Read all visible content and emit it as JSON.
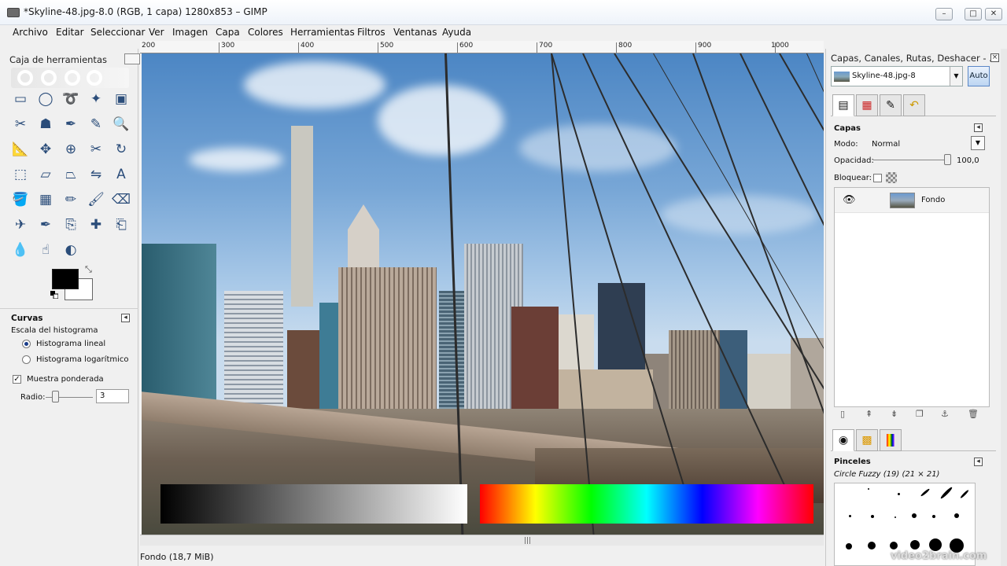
{
  "window": {
    "title": "*Skyline-48.jpg-8.0 (RGB, 1 capa) 1280x853 – GIMP",
    "controls": [
      "–",
      "□",
      "✕"
    ]
  },
  "menu": [
    "Archivo",
    "Editar",
    "Seleccionar",
    "Ver",
    "Imagen",
    "Capa",
    "Colores",
    "Herramientas",
    "Filtros",
    "Ventanas",
    "Ayuda"
  ],
  "toolbox": {
    "title": "Caja de herramientas",
    "tools": [
      "rect-select",
      "ellipse-select",
      "free-select",
      "fuzzy-select",
      "color-select",
      "scissors-select",
      "foreground-select",
      "paths",
      "color-picker",
      "zoom",
      "measure",
      "move",
      "align",
      "crop",
      "rotate",
      "scale",
      "shear",
      "perspective",
      "flip",
      "text",
      "bucket-fill",
      "blend",
      "pencil",
      "paintbrush",
      "eraser",
      "airbrush",
      "ink",
      "clone",
      "heal",
      "perspective-clone",
      "blur",
      "smudge",
      "dodge-burn"
    ],
    "fg_color": "#000000",
    "bg_color": "#ffffff"
  },
  "tool_options": {
    "title": "Curvas",
    "histogram_label": "Escala del histograma",
    "option_linear": "Histograma lineal",
    "option_log": "Histograma logarítmico",
    "weighted_label": "Muestra ponderada",
    "radius_label": "Radio:",
    "radius_value": "3"
  },
  "ruler": {
    "corner": "200",
    "labels": [
      "200",
      "300",
      "400",
      "500",
      "600",
      "700",
      "800",
      "900",
      "1000"
    ]
  },
  "status": {
    "text": "Fondo (18,7 MiB)"
  },
  "right_dock": {
    "title": "Capas, Canales, Rutas, Deshacer - ...",
    "image_name": "Skyline-48.jpg-8",
    "auto_label": "Auto",
    "layers_title": "Capas",
    "mode_label": "Modo:",
    "mode_value": "Normal",
    "opacity_label": "Opacidad:",
    "opacity_value": "100,0",
    "lock_label": "Bloquear:",
    "layer_name": "Fondo",
    "brushes_title": "Pinceles",
    "brush_name": "Circle Fuzzy (19) (21 × 21)"
  },
  "watermark": "video2brain.com"
}
